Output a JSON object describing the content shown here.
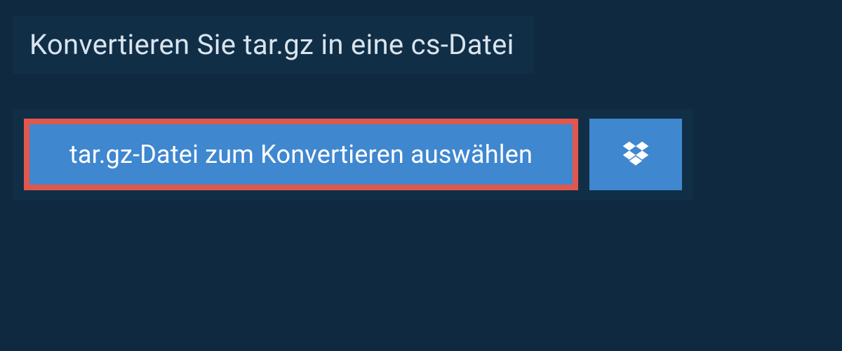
{
  "title": "Konvertieren Sie tar.gz in eine cs-Datei",
  "select_label": "tar.gz-Datei zum Konvertieren auswählen"
}
